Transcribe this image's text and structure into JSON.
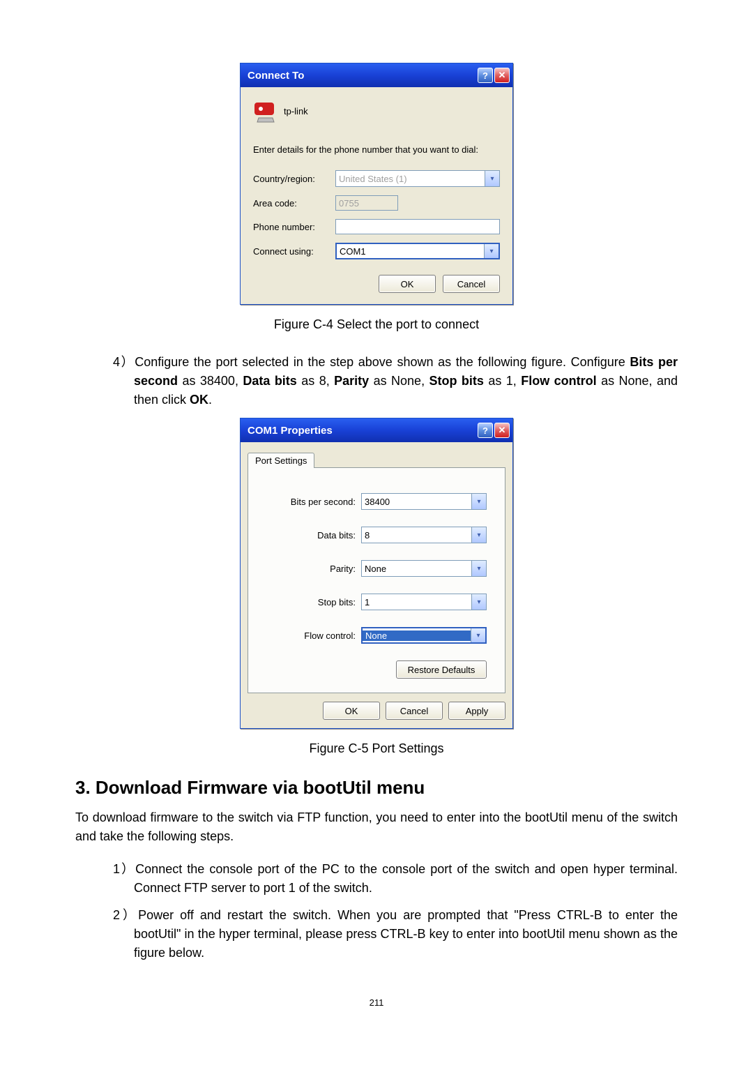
{
  "connect_dialog": {
    "title": "Connect To",
    "icon_name": "tp-link",
    "prompt": "Enter details for the phone number that you want to dial:",
    "country_label": "Country/region:",
    "country_value": "United States (1)",
    "area_label": "Area code:",
    "area_value": "0755",
    "phone_label": "Phone number:",
    "phone_value": "",
    "connect_label": "Connect using:",
    "connect_value": "COM1",
    "ok": "OK",
    "cancel": "Cancel"
  },
  "caption1": "Figure C-4 Select the port to connect",
  "step4_num": "4）",
  "step4_a": "Configure the port selected in the step above shown as the following figure. Configure ",
  "step4_b": "Bits per second",
  "step4_c": " as 38400, ",
  "step4_d": "Data bits",
  "step4_e": " as 8, ",
  "step4_f": "Parity",
  "step4_g": " as None, ",
  "step4_h": "Stop bits",
  "step4_i": " as 1, ",
  "step4_j": "Flow control",
  "step4_k": " as None, and then click ",
  "step4_l": "OK",
  "step4_m": ".",
  "com_dialog": {
    "title": "COM1 Properties",
    "tab": "Port Settings",
    "bits_label": "Bits per second:",
    "bits_value": "38400",
    "databits_label": "Data bits:",
    "databits_value": "8",
    "parity_label": "Parity:",
    "parity_value": "None",
    "stopbits_label": "Stop bits:",
    "stopbits_value": "1",
    "flow_label": "Flow control:",
    "flow_value": "None",
    "restore": "Restore Defaults",
    "ok": "OK",
    "cancel": "Cancel",
    "apply": "Apply"
  },
  "caption2": "Figure C-5    Port Settings",
  "section_title": "3.  Download Firmware via bootUtil menu",
  "section_para": "To download firmware to the switch via FTP function, you need to enter into the bootUtil menu of the switch and take the following steps.",
  "step1_num": "1）",
  "step1_text": "Connect the console port of the PC to the console port of the switch and open hyper terminal. Connect FTP server to port 1 of the switch.",
  "step2_num": "2）",
  "step2_text": "Power off and restart the switch. When you are prompted that \"Press CTRL-B to enter the bootUtil\" in the hyper terminal, please press CTRL-B key to enter into bootUtil menu shown as the figure below.",
  "page_number": "211"
}
